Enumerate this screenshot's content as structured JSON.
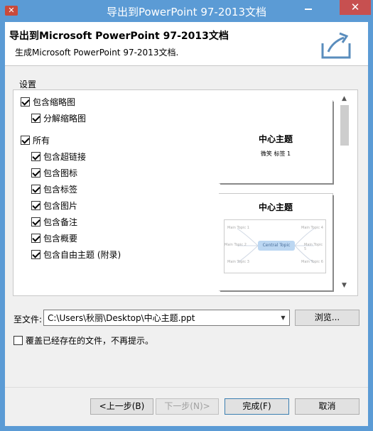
{
  "window": {
    "title": "导出到PowerPoint 97-2013文档",
    "app_icon_glyph": "✕",
    "minimize_icon": "minimize-icon",
    "close_icon": "close-icon",
    "close_glyph": "✕"
  },
  "header": {
    "title": "导出到Microsoft PowerPoint 97-2013文档",
    "subtitle": "生成Microsoft PowerPoint 97-2013文档."
  },
  "settings": {
    "group_label": "设置",
    "options": [
      {
        "label": "包含缩略图",
        "checked": true
      },
      {
        "label": "分解缩略图",
        "checked": true
      },
      {
        "label": "所有",
        "checked": true
      },
      {
        "label": "包含超链接",
        "checked": true
      },
      {
        "label": "包含图标",
        "checked": true
      },
      {
        "label": "包含标签",
        "checked": true
      },
      {
        "label": "包含图片",
        "checked": true
      },
      {
        "label": "包含备注",
        "checked": true
      },
      {
        "label": "包含概要",
        "checked": true
      },
      {
        "label": "包含自由主题 (附录)",
        "checked": true
      }
    ]
  },
  "preview": {
    "slide1": {
      "title": "中心主题",
      "subtitle": "微笑 标签 1"
    },
    "slide2": {
      "title": "中心主题",
      "center_node": "Central Topic",
      "nodes": [
        "Main Topic 1",
        "Main Topic 2",
        "Main Topic 3",
        "Main Topic 4",
        "Main Topic 5",
        "Main Topic 6"
      ]
    },
    "scroll_up_glyph": "▲",
    "scroll_down_glyph": "▼"
  },
  "file": {
    "label": "至文件:",
    "value": "C:\\Users\\秋丽\\Desktop\\中心主题.ppt",
    "dropdown_glyph": "▼",
    "browse_label": "浏览..."
  },
  "overwrite": {
    "label": "覆盖已经存在的文件，不再提示。",
    "checked": false
  },
  "footer": {
    "back_label": "<上一步(B)",
    "next_label": "下一步(N)>",
    "finish_label": "完成(F)",
    "cancel_label": "取消"
  },
  "colors": {
    "titlebar": "#5b9bd5",
    "close_button": "#c75050",
    "app_icon": "#c94a3b"
  }
}
